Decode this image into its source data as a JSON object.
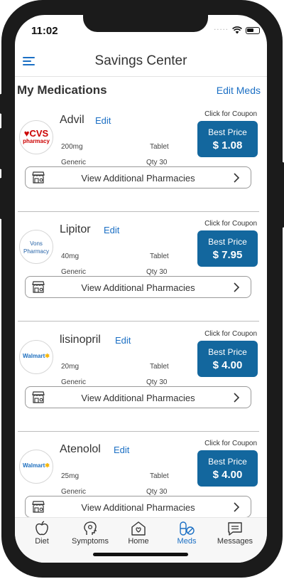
{
  "status_bar": {
    "time": "11:02",
    "signal": "·····"
  },
  "header": {
    "title": "Savings Center"
  },
  "list": {
    "title": "My Medications",
    "edit_label": "Edit Meds"
  },
  "medications": [
    {
      "name": "Advil",
      "edit": "Edit",
      "dose": "200mg",
      "form": "Tablet",
      "type": "Generic",
      "qty": "Qty 30",
      "coupon_label": "Click for Coupon",
      "best_label": "Best Price",
      "price": "$ 1.08",
      "pharmacy": {
        "brand": "CVS",
        "sub": "pharmacy",
        "icon": "heart-icon"
      },
      "pharmacies_label": "View Additional Pharmacies"
    },
    {
      "name": "Lipitor",
      "edit": "Edit",
      "dose": "40mg",
      "form": "Tablet",
      "type": "Generic",
      "qty": "Qty 30",
      "coupon_label": "Click for Coupon",
      "best_label": "Best Price",
      "price": "$ 7.95",
      "pharmacy": {
        "brand": "Vons",
        "sub": "Pharmacy"
      },
      "pharmacies_label": "View Additional Pharmacies"
    },
    {
      "name": "lisinopril",
      "edit": "Edit",
      "dose": "20mg",
      "form": "Tablet",
      "type": "Generic",
      "qty": "Qty 30",
      "coupon_label": "Click for Coupon",
      "best_label": "Best Price",
      "price": "$ 4.00",
      "pharmacy": {
        "brand": "Walmart",
        "icon": "spark-icon"
      },
      "pharmacies_label": "View Additional Pharmacies"
    },
    {
      "name": "Atenolol",
      "edit": "Edit",
      "dose": "25mg",
      "form": "Tablet",
      "type": "Generic",
      "qty": "Qty 30",
      "coupon_label": "Click for Coupon",
      "best_label": "Best Price",
      "price": "$ 4.00",
      "pharmacy": {
        "brand": "Walmart",
        "icon": "spark-icon"
      },
      "pharmacies_label": "View Additional Pharmacies"
    }
  ],
  "tabs": [
    {
      "label": "Diet",
      "icon": "apple-icon"
    },
    {
      "label": "Symptoms",
      "icon": "head-icon"
    },
    {
      "label": "Home",
      "icon": "home-heart-icon"
    },
    {
      "label": "Meds",
      "icon": "pills-icon",
      "active": true
    },
    {
      "label": "Messages",
      "icon": "message-icon"
    }
  ],
  "colors": {
    "accent": "#1b6fc4",
    "price_button": "#13679e",
    "cvs_red": "#cc0000",
    "walmart_yellow": "#f5b400"
  }
}
